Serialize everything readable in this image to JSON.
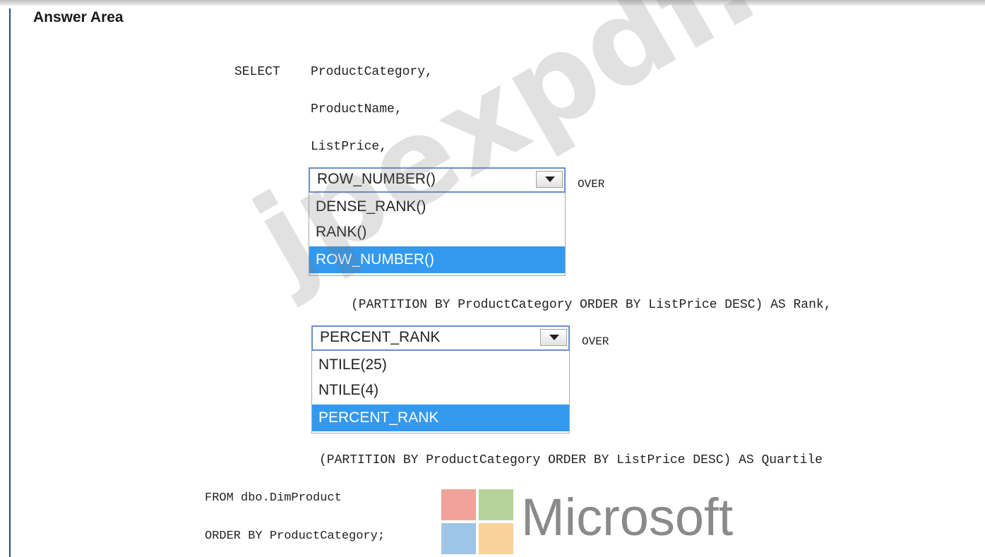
{
  "answer_area": {
    "title": "Answer Area"
  },
  "sql": {
    "select_keyword": "SELECT",
    "col1": "ProductCategory,",
    "col2": "ProductName,",
    "col3": "ListPrice,",
    "over1": "OVER",
    "partition1": "(PARTITION BY ProductCategory ORDER BY ListPrice DESC) AS Rank,",
    "over2": "OVER",
    "partition2": "(PARTITION BY ProductCategory ORDER BY ListPrice DESC) AS Quartile",
    "from_line": "FROM dbo.DimProduct",
    "order_line": "ORDER BY ProductCategory;"
  },
  "dropdown1": {
    "selected_value": "ROW_NUMBER()",
    "options": [
      {
        "label": "DENSE_RANK()",
        "selected": false
      },
      {
        "label": "RANK()",
        "selected": false
      },
      {
        "label": "ROW_NUMBER()",
        "selected": true
      }
    ]
  },
  "dropdown2": {
    "selected_value": "PERCENT_RANK",
    "options": [
      {
        "label": "NTILE(25)",
        "selected": false
      },
      {
        "label": "NTILE(4)",
        "selected": false
      },
      {
        "label": "PERCENT_RANK",
        "selected": true
      }
    ]
  },
  "watermark": {
    "text": "jpexpdf.com"
  },
  "logo": {
    "wordmark": "Microsoft",
    "colors": {
      "red": "#f1a39a",
      "green": "#b5d39a",
      "blue": "#9ec5e8",
      "yellow": "#f8d29a"
    }
  }
}
